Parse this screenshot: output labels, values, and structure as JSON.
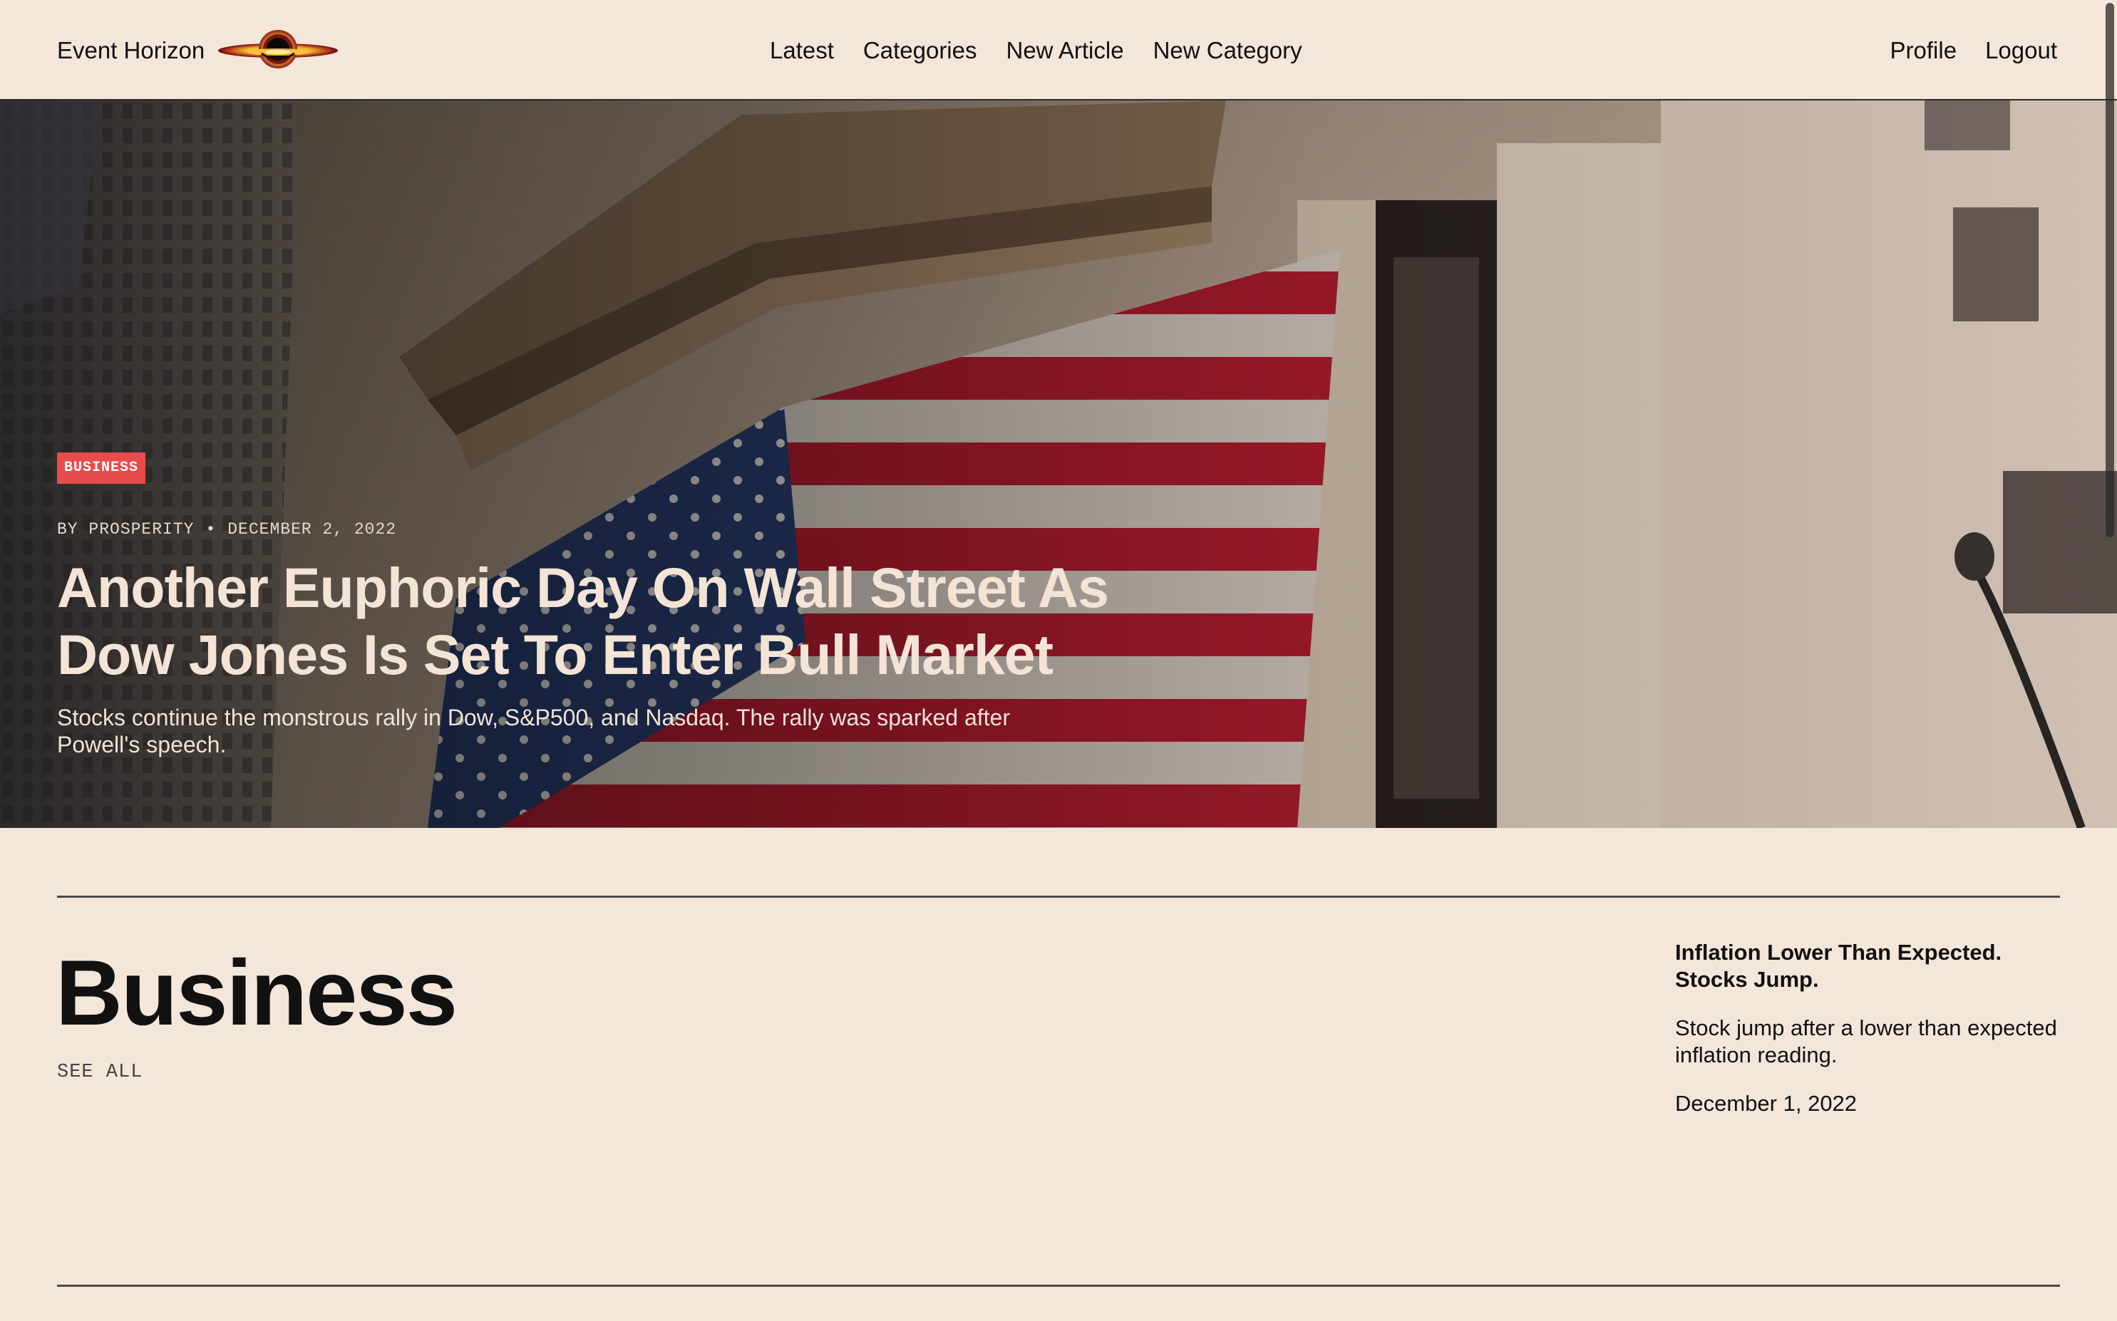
{
  "site": {
    "brand": "Event Horizon",
    "logo_icon": "black-hole-logo-icon"
  },
  "nav": {
    "center": [
      "Latest",
      "Categories",
      "New Article",
      "New Category"
    ],
    "right": [
      "Profile",
      "Logout"
    ]
  },
  "hero": {
    "category": "BUSINESS",
    "author": "BY PROSPERITY",
    "separator": "•",
    "date": "DECEMBER 2, 2022",
    "title": "Another Euphoric Day On Wall Street As Dow Jones Is Set To Enter Bull Market",
    "subtitle": "Stocks continue the monstrous rally in Dow, S&P500, and Nasdaq. The rally was sparked after Powell's speech.",
    "image_icon": "stock-exchange-photo",
    "badge_color": "#e94b4b"
  },
  "section": {
    "title": "Business",
    "see_all": "SEE ALL"
  },
  "side_article": {
    "title": "Inflation Lower Than Expected. Stocks Jump.",
    "description": "Stock jump after a lower than expected inflation reading.",
    "date": "December 1, 2022"
  },
  "colors": {
    "background": "#f4e6d9",
    "text": "#111111",
    "accent": "#e94b4b"
  }
}
